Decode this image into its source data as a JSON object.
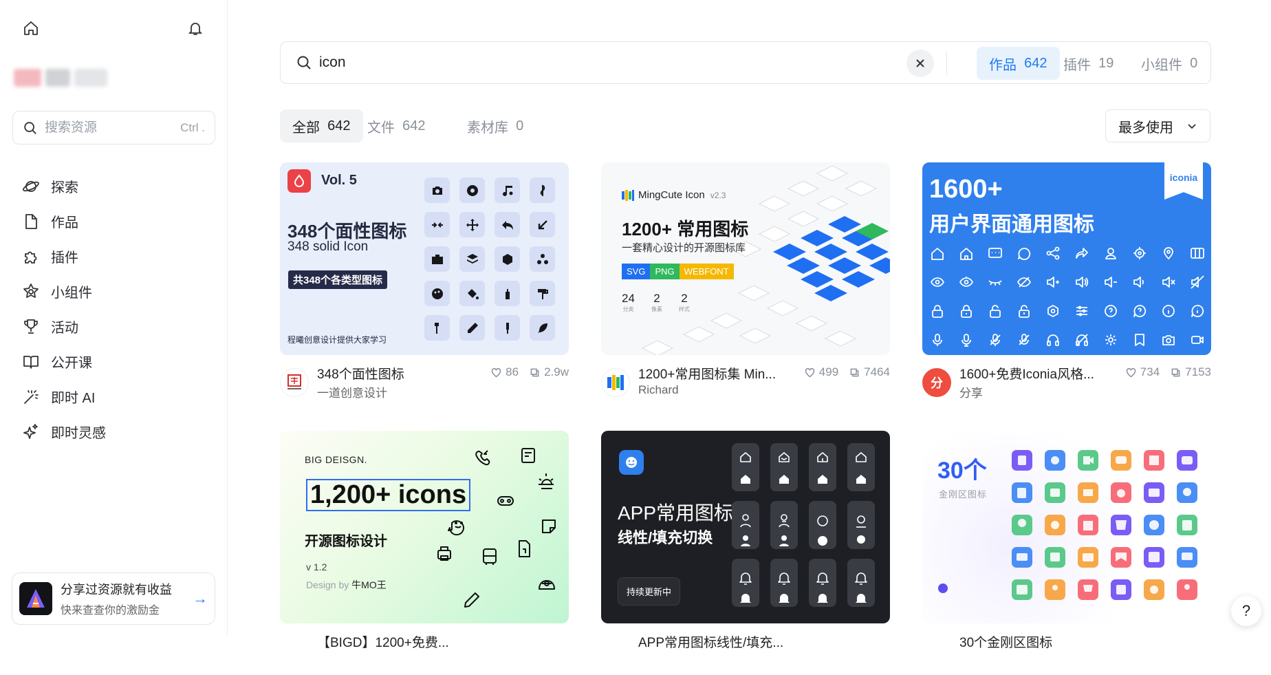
{
  "sidebar": {
    "search_placeholder": "搜索资源",
    "search_shortcut": "Ctrl .",
    "nav": [
      {
        "label": "探索",
        "icon": "planet-icon"
      },
      {
        "label": "作品",
        "icon": "file-icon"
      },
      {
        "label": "插件",
        "icon": "puzzle-icon"
      },
      {
        "label": "小组件",
        "icon": "widget-star-icon"
      },
      {
        "label": "活动",
        "icon": "trophy-icon"
      },
      {
        "label": "公开课",
        "icon": "book-icon"
      },
      {
        "label": "即时 AI",
        "icon": "magic-wand-icon"
      },
      {
        "label": "即时灵感",
        "icon": "sparkles-icon"
      }
    ],
    "promo": {
      "line1": "分享过资源就有收益",
      "line2": "快来查查你的激励金"
    }
  },
  "search": {
    "query": "icon"
  },
  "scope_tabs": [
    {
      "label": "作品",
      "count": "642",
      "active": true
    },
    {
      "label": "插件",
      "count": "19",
      "active": false
    },
    {
      "label": "小组件",
      "count": "0",
      "active": false
    }
  ],
  "filter_tabs": [
    {
      "label": "全部",
      "count": "642",
      "active": true
    },
    {
      "label": "文件",
      "count": "642",
      "active": false
    },
    {
      "label": "素材库",
      "count": "0",
      "active": false
    }
  ],
  "sort": {
    "label": "最多使用"
  },
  "cards": [
    {
      "title": "348个面性图标",
      "author": "一道创意设计",
      "likes": "86",
      "uses": "2.9w",
      "thumb": {
        "vol": "Vol. 5",
        "heading": "348个面性图标",
        "sub": "348 solid Icon",
        "badge": "共348个各类型图标",
        "footer": "程曦创意设计提供大家学习"
      }
    },
    {
      "title": "1200+常用图标集 Min...",
      "author": "Richard",
      "likes": "499",
      "uses": "7464",
      "thumb": {
        "brand": "MingCute Icon",
        "version": "v2.3",
        "heading": "1200+ 常用图标",
        "sub": "一套精心设计的开源图标库",
        "formats": [
          "SVG",
          "PNG",
          "WEBFONT"
        ],
        "stats": [
          {
            "n": "24",
            "l": "分类"
          },
          {
            "n": "2",
            "l": "像素"
          },
          {
            "n": "2",
            "l": "样式"
          }
        ]
      }
    },
    {
      "title": "1600+免费Iconia风格...",
      "author": "分享",
      "author_initial": "分",
      "likes": "734",
      "uses": "7153",
      "thumb": {
        "line1": "1600+",
        "line2": "用户界面通用图标",
        "tag": "iconia"
      }
    },
    {
      "title": "【BIGD】1200+免费...",
      "thumb": {
        "brand": "BIG DEISGN.",
        "heading": "1,200+ icons",
        "sub": "开源图标设计",
        "version": "v 1.2",
        "design_by": "Design by",
        "designer": "牛MO王"
      }
    },
    {
      "title": "APP常用图标线性/填充...",
      "thumb": {
        "heading": "APP常用图标",
        "sub": "线性/填充切换",
        "button": "持续更新中"
      }
    },
    {
      "title": "30个金刚区图标",
      "thumb": {
        "heading": "30个",
        "sub": "金刚区图标"
      }
    }
  ],
  "colors": {
    "accent": "#1f7af0",
    "iconia_blue": "#2f80ed",
    "dark_card": "#1e1f24"
  }
}
